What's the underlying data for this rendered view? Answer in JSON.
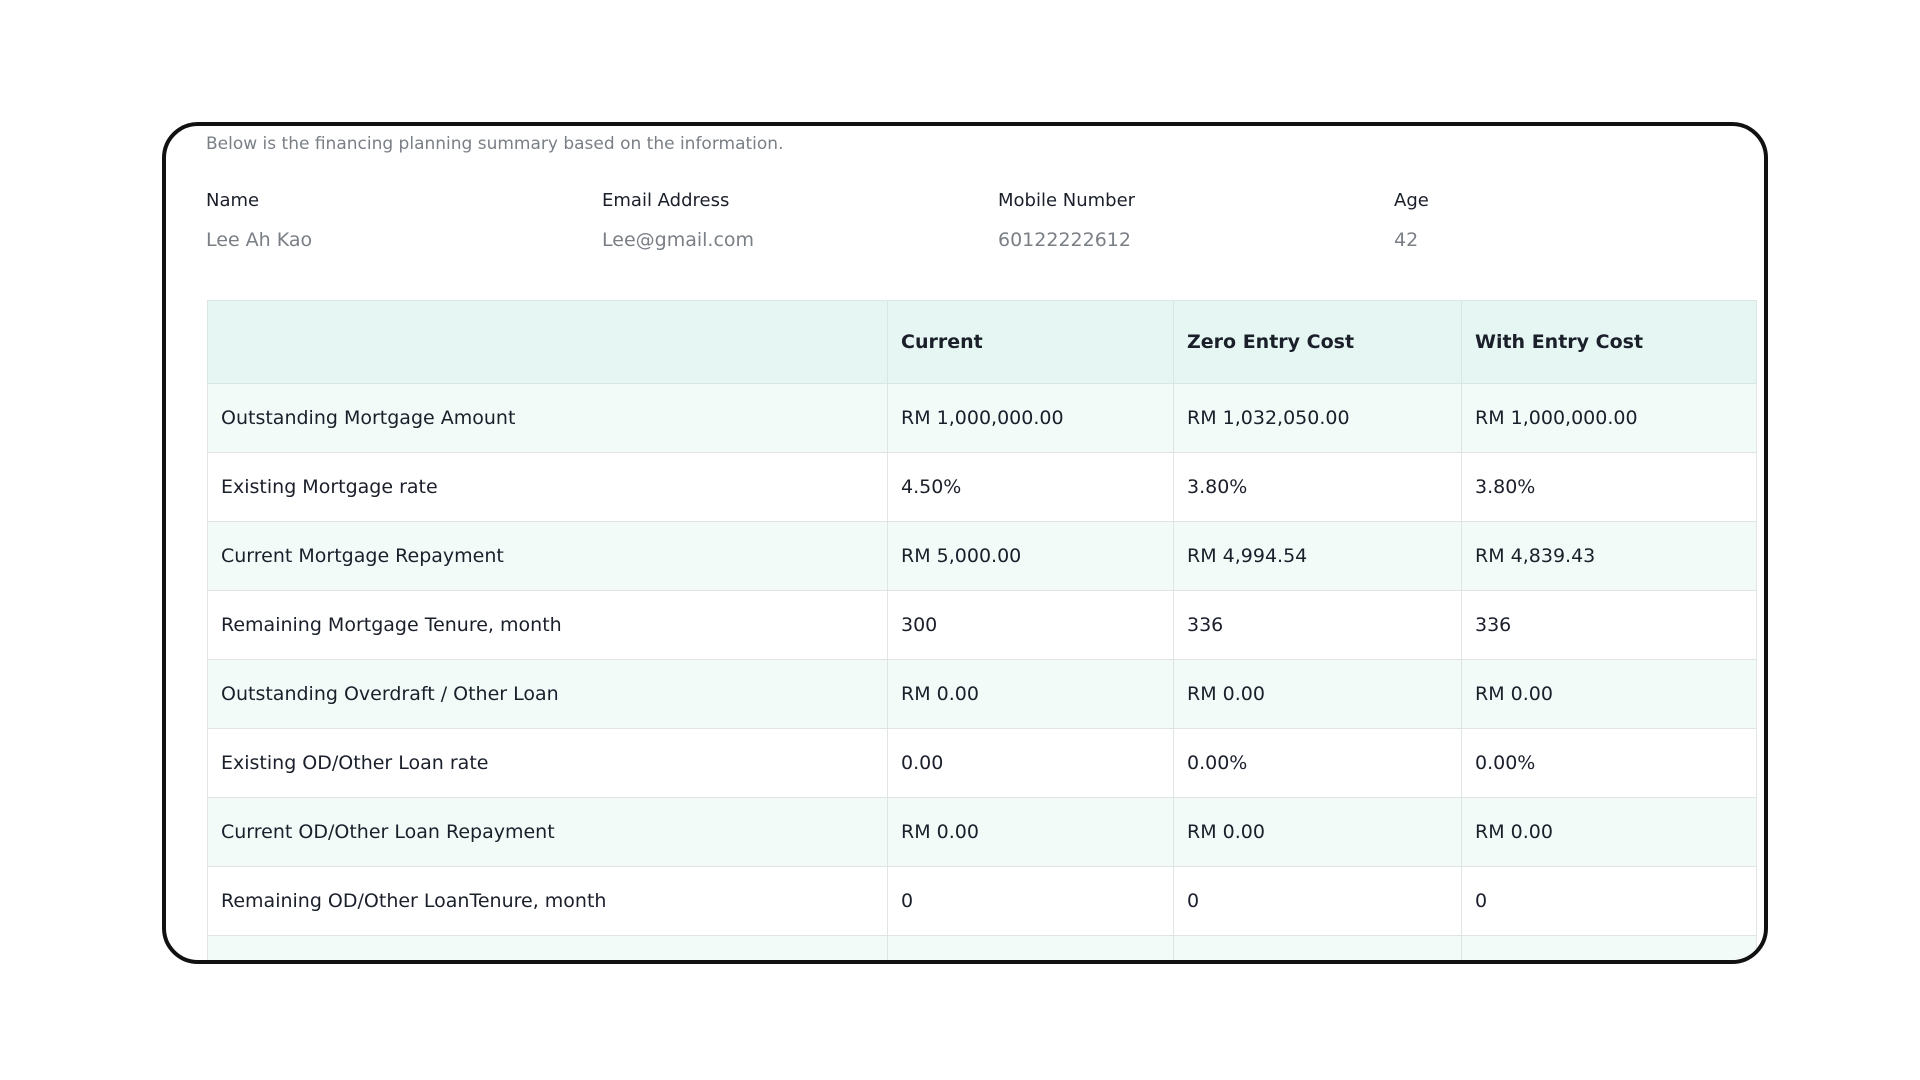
{
  "intro": "Below is the financing planning summary based on the information.",
  "info": [
    {
      "label": "Name",
      "value": "Lee Ah Kao"
    },
    {
      "label": "Email Address",
      "value": "Lee@gmail.com"
    },
    {
      "label": "Mobile Number",
      "value": "60122222612"
    },
    {
      "label": "Age",
      "value": "42"
    }
  ],
  "table": {
    "headers": [
      "",
      "Current",
      "Zero Entry Cost",
      "With Entry Cost"
    ],
    "rows": [
      [
        "Outstanding Mortgage Amount",
        "RM 1,000,000.00",
        "RM 1,032,050.00",
        "RM 1,000,000.00"
      ],
      [
        "Existing Mortgage rate",
        "4.50%",
        "3.80%",
        "3.80%"
      ],
      [
        "Current Mortgage Repayment",
        "RM 5,000.00",
        "RM 4,994.54",
        "RM 4,839.43"
      ],
      [
        "Remaining Mortgage Tenure, month",
        "300",
        "336",
        "336"
      ],
      [
        "Outstanding Overdraft / Other Loan",
        "RM 0.00",
        "RM 0.00",
        "RM 0.00"
      ],
      [
        "Existing OD/Other Loan rate",
        "0.00",
        "0.00%",
        "0.00%"
      ],
      [
        "Current OD/Other Loan Repayment",
        "RM 0.00",
        "RM 0.00",
        "RM 0.00"
      ],
      [
        "Remaining OD/Other LoanTenure, month",
        "0",
        "0",
        "0"
      ]
    ]
  },
  "colors": {
    "header_bg": "#e6f7f3",
    "row_alt_bg": "#f3fbf9",
    "frame_border": "#111111",
    "muted_text": "#7a7f86"
  }
}
